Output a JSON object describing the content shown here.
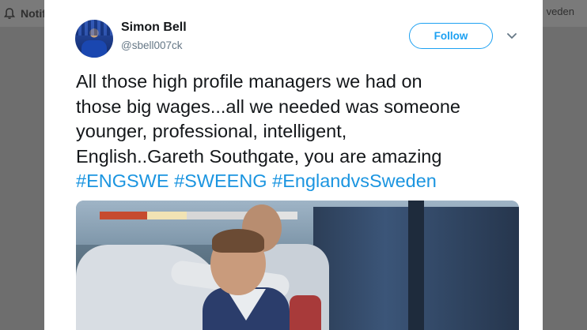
{
  "background": {
    "left_label": "Notifi",
    "right_label": "veden"
  },
  "tweet": {
    "author_name": "Simon Bell",
    "author_handle": "@sbell007ck",
    "follow_label": "Follow",
    "text_lines": [
      "All those high profile managers we had on",
      "those big wages...all we needed was someone",
      "younger, professional, intelligent,",
      "English..Gareth Southgate, you are amazing"
    ],
    "hashtags": [
      "#ENGSWE",
      "#SWEENG",
      "#EnglandvsSweden"
    ]
  },
  "colors": {
    "accent": "#1da1f2",
    "hashtag": "#1b95e0",
    "text": "#14171a",
    "secondary_text": "#657786",
    "overlay": "#6e6e6e"
  },
  "icons": {
    "notification": "bell-icon",
    "caret": "chevron-down-icon"
  }
}
